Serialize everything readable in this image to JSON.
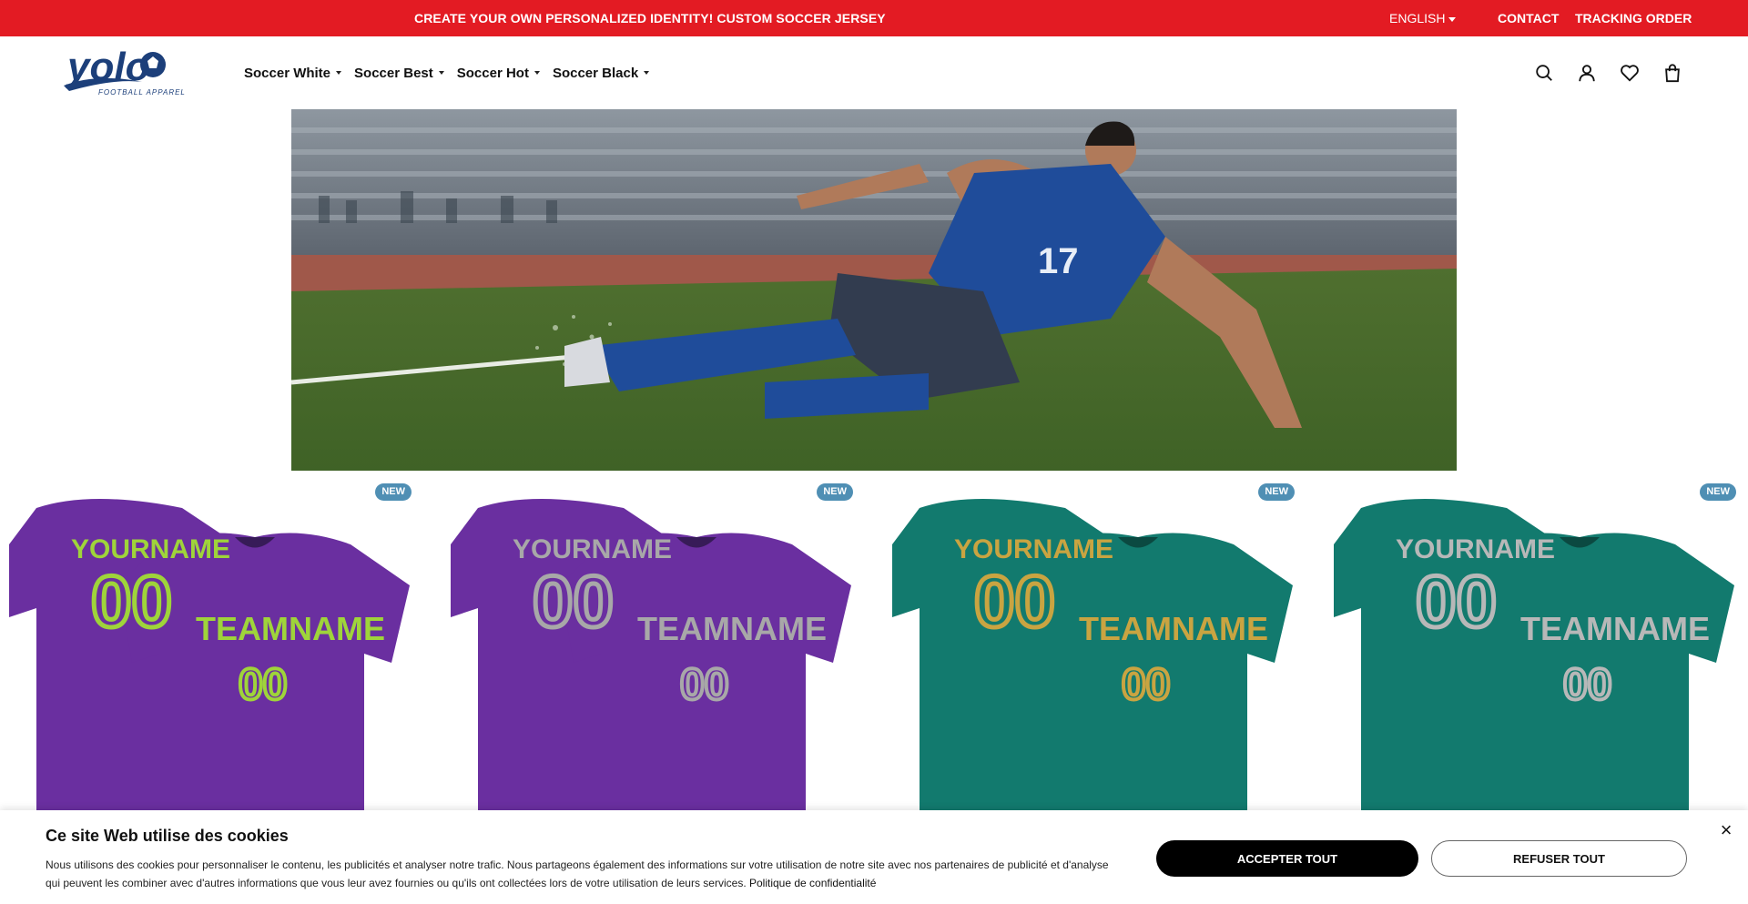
{
  "topbar": {
    "promo": "CREATE YOUR OWN PERSONALIZED IDENTITY! CUSTOM SOCCER JERSEY",
    "language": "ENGLISH",
    "contact": "CONTACT",
    "tracking": "TRACKING ORDER",
    "bg_color": "#e31b23"
  },
  "header": {
    "logo_text": "yolo",
    "logo_tagline": "FOOTBALL APPAREL",
    "nav": [
      {
        "label": "Soccer White"
      },
      {
        "label": "Soccer Best"
      },
      {
        "label": "Soccer Hot"
      },
      {
        "label": "Soccer Black"
      }
    ],
    "icons": [
      "search-icon",
      "account-icon",
      "wishlist-icon",
      "cart-icon"
    ]
  },
  "hero": {
    "description_icon": "soccer-player-sliding-image",
    "jersey_number": "17"
  },
  "products": [
    {
      "badge": "NEW",
      "jersey_color": "#6a2fa0",
      "accent_color": "#9fd43a",
      "name_text": "YOURNAME",
      "team_text": "TEAMNAME",
      "number_text": "00"
    },
    {
      "badge": "NEW",
      "jersey_color": "#6a2fa0",
      "accent_color": "#a8a8a8",
      "name_text": "YOURNAME",
      "team_text": "TEAMNAME",
      "number_text": "00"
    },
    {
      "badge": "NEW",
      "jersey_color": "#127a6e",
      "accent_color": "#c9a441",
      "name_text": "YOURNAME",
      "team_text": "TEAMNAME",
      "number_text": "00"
    },
    {
      "badge": "NEW",
      "jersey_color": "#127a6e",
      "accent_color": "#b8b8b8",
      "name_text": "YOURNAME",
      "team_text": "TEAMNAME",
      "number_text": "00"
    }
  ],
  "cookie": {
    "title": "Ce site Web utilise des cookies",
    "text": "Nous utilisons des cookies pour personnaliser le contenu, les publicités et analyser notre trafic. Nous partageons également des informations sur votre utilisation de notre site avec nos partenaires de publicité et d'analyse qui peuvent les combiner avec d'autres informations que vous leur avez fournies ou qu'ils ont collectées lors de votre utilisation de leurs services. ",
    "policy_link": "Politique de confidentialité",
    "accept": "ACCEPTER TOUT",
    "refuse": "REFUSER TOUT",
    "close": "×"
  }
}
